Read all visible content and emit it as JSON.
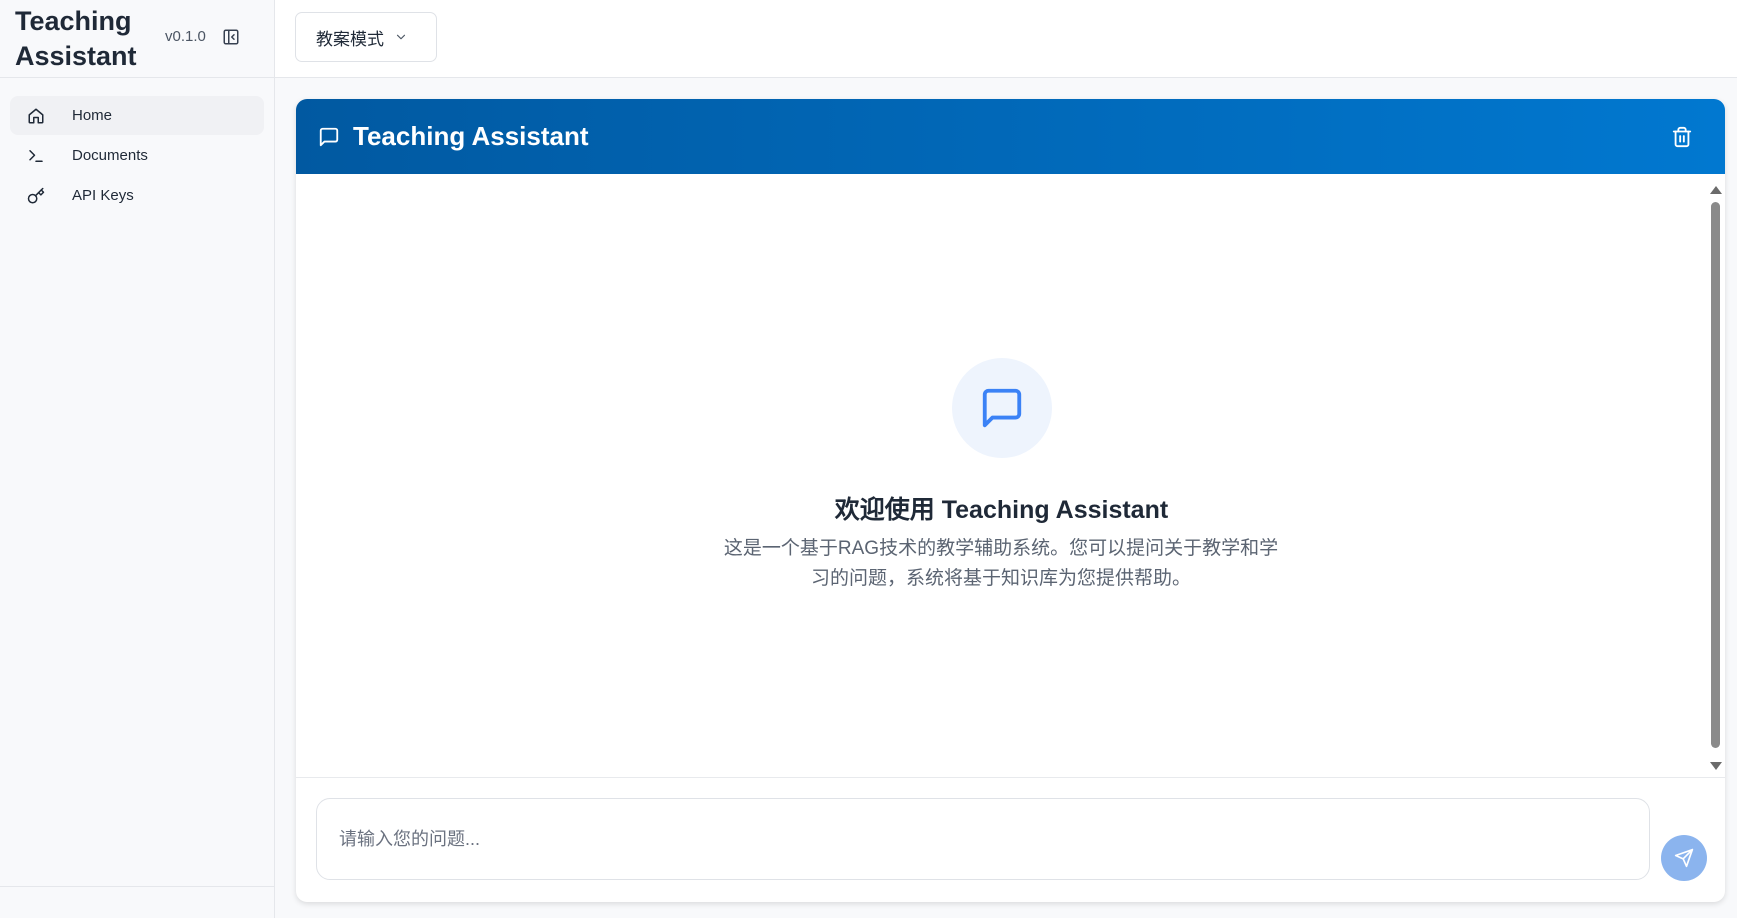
{
  "app": {
    "title": "Teaching Assistant",
    "version": "v0.1.0"
  },
  "sidebar": {
    "items": [
      {
        "label": "Home",
        "icon": "home-icon",
        "active": true
      },
      {
        "label": "Documents",
        "icon": "terminal-icon",
        "active": false
      },
      {
        "label": "API Keys",
        "icon": "key-icon",
        "active": false
      }
    ]
  },
  "topbar": {
    "mode_select": {
      "value": "教案模式"
    }
  },
  "chat": {
    "title": "Teaching Assistant",
    "welcome_title": "欢迎使用 Teaching Assistant",
    "welcome_desc": "这是一个基于RAG技术的教学辅助系统。您可以提问关于教学和学习的问题，系统将基于知识库为您提供帮助。",
    "input_placeholder": "请输入您的问题...",
    "input_value": ""
  },
  "colors": {
    "header_gradient_start": "#0159a1",
    "header_gradient_end": "#0178d0",
    "accent": "#3b82f6",
    "send_button": "#8bb4ee",
    "welcome_icon_bg": "#eef4fd"
  }
}
